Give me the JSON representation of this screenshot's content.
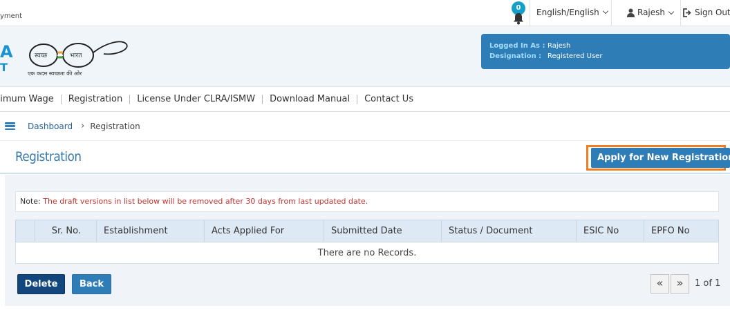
{
  "topbar": {
    "ministry_text": "yment",
    "notification_count": "0",
    "language": "English/English",
    "user_name": "Rajesh",
    "signout_label": "Sign Out"
  },
  "header": {
    "brand_letter_1": "A",
    "brand_letter_2": "T",
    "logo_left": "स्वच्छ",
    "logo_right": "भारत",
    "logo_caption": "एक कदम स्वच्छता की ओर",
    "logged_in_label": "Logged In As :",
    "logged_in_value": "Rajesh",
    "designation_label": "Designation :",
    "designation_value": "Registered User"
  },
  "nav": {
    "items": [
      {
        "label": "nimum Wage"
      },
      {
        "label": "Registration"
      },
      {
        "label": "License Under CLRA/ISMW"
      },
      {
        "label": "Download Manual"
      },
      {
        "label": "Contact Us"
      }
    ]
  },
  "breadcrumb": {
    "home": "Dashboard",
    "separator": "›",
    "current": "Registration"
  },
  "page": {
    "title": "Registration",
    "apply_button": "Apply for New Registration"
  },
  "note": {
    "label": "Note:",
    "text": " The draft versions in list below will be removed after 30 days from last updated date."
  },
  "table": {
    "columns": [
      "Sr. No.",
      "Establishment",
      "Acts Applied For",
      "Submitted Date",
      "Status / Document",
      "ESIC No",
      "EPFO No"
    ],
    "empty_text": "There are no Records."
  },
  "actions": {
    "delete_label": "Delete",
    "back_label": "Back"
  },
  "pager": {
    "prev_symbol": "«",
    "next_symbol": "»",
    "info": "1 of 1"
  },
  "colors": {
    "primary": "#2f7db6",
    "dark_primary": "#12467c",
    "highlight": "#ef7d22",
    "note_red": "#c9302c",
    "badge": "#16a0c9"
  }
}
